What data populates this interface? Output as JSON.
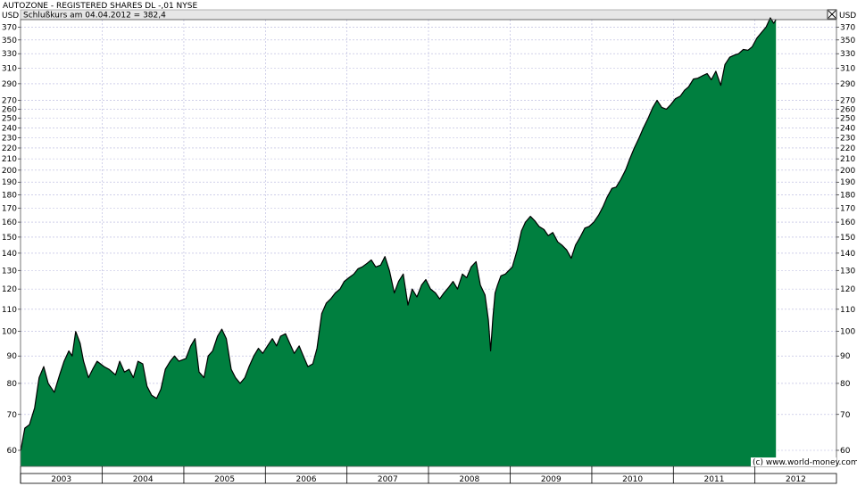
{
  "header": {
    "title": "AUTOZONE - REGISTERED SHARES DL -,01 NYSE",
    "closing_note": "Schlußkurs am 04.04.2012 = 382,4",
    "close_icon": "close-x-icon"
  },
  "copyright": "(c) www.world-money.com",
  "colors": {
    "area_fill": "#007f3f",
    "line": "#000000",
    "grid": "#b4b4dc",
    "header_bar": "#e6e6e6"
  },
  "chart_data": {
    "type": "area",
    "y_scale": "log",
    "ylabel_left": "USD",
    "ylabel_right": "USD",
    "ylim": [
      56,
      382
    ],
    "grid": true,
    "y_ticks": [
      60,
      70,
      80,
      90,
      100,
      110,
      120,
      130,
      140,
      150,
      160,
      170,
      180,
      190,
      200,
      210,
      220,
      230,
      240,
      250,
      260,
      270,
      290,
      310,
      330,
      350,
      370
    ],
    "x_ticks": [
      "2003",
      "2004",
      "2005",
      "2006",
      "2007",
      "2008",
      "2009",
      "2010",
      "2011",
      "2012"
    ],
    "x_range": [
      "2003-01-01",
      "2012-12-31"
    ],
    "series": [
      {
        "x": [
          "2003-01-02",
          "2003-01-20",
          "2003-02-10",
          "2003-03-05",
          "2003-03-25",
          "2003-04-15",
          "2003-05-05",
          "2003-06-01",
          "2003-06-25",
          "2003-07-15",
          "2003-08-05",
          "2003-08-20",
          "2003-09-05",
          "2003-09-25",
          "2003-10-10",
          "2003-11-01",
          "2003-11-20",
          "2003-12-10",
          "2004-01-10",
          "2004-02-01",
          "2004-03-01",
          "2004-03-20",
          "2004-04-10",
          "2004-05-01",
          "2004-05-20",
          "2004-06-10",
          "2004-07-01",
          "2004-07-20",
          "2004-08-10",
          "2004-09-01",
          "2004-09-20",
          "2004-10-10",
          "2004-11-01",
          "2004-11-20",
          "2004-12-10",
          "2005-01-10",
          "2005-02-01",
          "2005-02-20",
          "2005-03-10",
          "2005-04-01",
          "2005-04-20",
          "2005-05-10",
          "2005-06-01",
          "2005-06-20",
          "2005-07-10",
          "2005-08-01",
          "2005-08-20",
          "2005-09-10",
          "2005-10-01",
          "2005-10-20",
          "2005-11-10",
          "2005-12-01",
          "2005-12-20",
          "2006-01-10",
          "2006-02-01",
          "2006-02-20",
          "2006-03-10",
          "2006-04-01",
          "2006-04-20",
          "2006-05-10",
          "2006-06-01",
          "2006-06-20",
          "2006-07-10",
          "2006-08-01",
          "2006-08-20",
          "2006-09-10",
          "2006-10-01",
          "2006-10-20",
          "2006-11-10",
          "2006-12-01",
          "2006-12-20",
          "2007-01-10",
          "2007-02-01",
          "2007-02-20",
          "2007-03-10",
          "2007-04-01",
          "2007-04-20",
          "2007-05-10",
          "2007-06-01",
          "2007-06-20",
          "2007-07-10",
          "2007-08-01",
          "2007-08-20",
          "2007-09-10",
          "2007-10-01",
          "2007-10-20",
          "2007-11-10",
          "2007-12-01",
          "2007-12-20",
          "2008-01-10",
          "2008-02-01",
          "2008-02-20",
          "2008-03-10",
          "2008-04-01",
          "2008-04-20",
          "2008-05-10",
          "2008-06-01",
          "2008-06-20",
          "2008-07-10",
          "2008-08-01",
          "2008-08-20",
          "2008-09-10",
          "2008-09-25",
          "2008-10-05",
          "2008-10-15",
          "2008-10-25",
          "2008-11-05",
          "2008-11-20",
          "2008-12-10",
          "2009-01-10",
          "2009-02-01",
          "2009-02-20",
          "2009-03-10",
          "2009-04-01",
          "2009-04-20",
          "2009-05-10",
          "2009-06-01",
          "2009-06-20",
          "2009-07-10",
          "2009-08-01",
          "2009-08-20",
          "2009-09-10",
          "2009-10-01",
          "2009-10-20",
          "2009-11-10",
          "2009-12-01",
          "2009-12-20",
          "2010-01-10",
          "2010-02-01",
          "2010-02-20",
          "2010-03-10",
          "2010-04-01",
          "2010-04-20",
          "2010-05-10",
          "2010-06-01",
          "2010-06-20",
          "2010-07-10",
          "2010-08-01",
          "2010-08-20",
          "2010-09-10",
          "2010-10-01",
          "2010-10-20",
          "2010-11-10",
          "2010-12-01",
          "2010-12-20",
          "2011-01-10",
          "2011-02-01",
          "2011-02-20",
          "2011-03-10",
          "2011-04-01",
          "2011-04-20",
          "2011-05-10",
          "2011-06-01",
          "2011-06-20",
          "2011-07-10",
          "2011-08-01",
          "2011-08-20",
          "2011-09-10",
          "2011-10-01",
          "2011-10-20",
          "2011-11-10",
          "2011-12-01",
          "2011-12-20",
          "2012-01-10",
          "2012-02-01",
          "2012-02-20",
          "2012-03-10",
          "2012-03-25",
          "2012-04-04"
        ],
        "values": [
          60,
          66,
          67,
          72,
          82,
          86,
          80,
          77,
          83,
          88,
          92,
          90,
          100,
          95,
          88,
          82,
          85,
          88,
          86,
          85,
          83,
          88,
          84,
          85,
          82,
          88,
          87,
          79,
          76,
          75,
          78,
          85,
          88,
          90,
          88,
          89,
          94,
          97,
          84,
          82,
          90,
          92,
          98,
          101,
          97,
          85,
          82,
          80,
          82,
          86,
          90,
          93,
          91,
          94,
          97,
          94,
          98,
          99,
          95,
          91,
          94,
          90,
          86,
          87,
          93,
          108,
          113,
          115,
          118,
          120,
          124,
          126,
          128,
          131,
          132,
          134,
          136,
          132,
          133,
          138,
          130,
          118,
          124,
          128,
          112,
          120,
          116,
          122,
          125,
          120,
          118,
          115,
          118,
          121,
          124,
          120,
          128,
          126,
          132,
          135,
          122,
          117,
          105,
          92,
          106,
          118,
          122,
          127,
          128,
          132,
          142,
          154,
          160,
          164,
          161,
          157,
          155,
          151,
          153,
          147,
          145,
          142,
          137,
          145,
          150,
          156,
          157,
          160,
          165,
          171,
          178,
          185,
          186,
          192,
          200,
          210,
          220,
          230,
          240,
          250,
          262,
          270,
          262,
          260,
          265,
          272,
          275,
          282,
          286,
          296,
          297,
          300,
          303,
          295,
          306,
          288,
          315,
          325,
          328,
          330,
          336,
          335,
          340,
          353,
          362,
          370,
          385,
          376,
          382
        ]
      }
    ]
  }
}
